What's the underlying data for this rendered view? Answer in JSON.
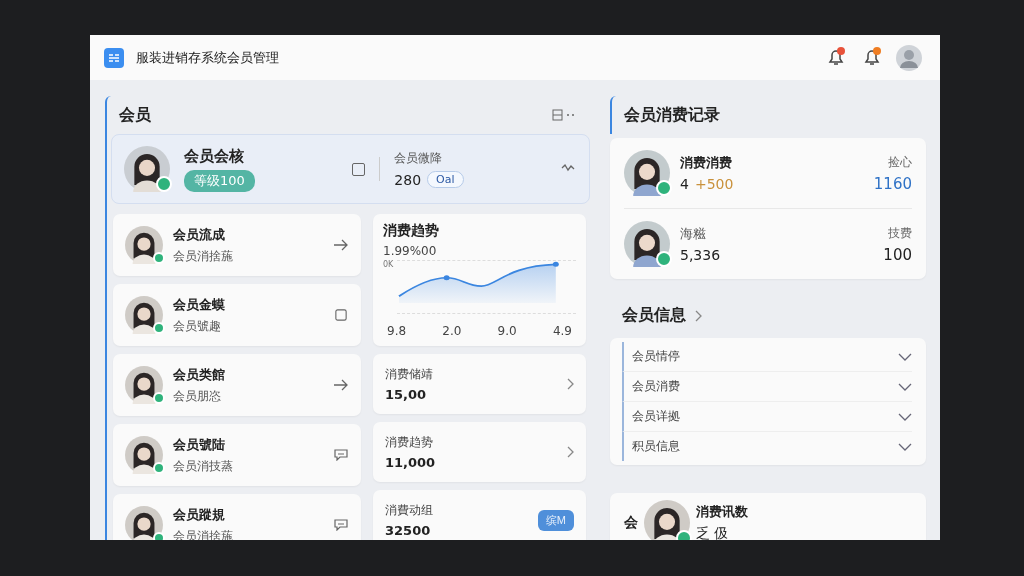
{
  "header": {
    "title": "服装进销存系统会员管理"
  },
  "members_panel": {
    "title": "会员",
    "featured": {
      "name": "会员会核",
      "level_badge": "等级100",
      "stat_label": "会员微降",
      "stat_value": "280",
      "stat_pill": "Oal",
      "checked": false
    },
    "members": [
      {
        "name": "会员流成",
        "subtitle": "会员消捨葹",
        "kind": "arrow"
      },
      {
        "name": "会员金蟆",
        "subtitle": "会员號趣",
        "kind": "square"
      },
      {
        "name": "会员类館",
        "subtitle": "会员朋恣",
        "kind": "arrow"
      },
      {
        "name": "会员號陆",
        "subtitle": "会员消技蒸",
        "kind": "chat"
      },
      {
        "name": "会员蹤規",
        "subtitle": "会员消捨葹",
        "kind": "chat"
      }
    ],
    "trend": {
      "title": "消费趋势",
      "total": "1.99%00",
      "y_label": "0K",
      "x_labels": [
        "9.8",
        "2.0",
        "9.0",
        "4.9"
      ]
    },
    "stats": [
      {
        "label": "消费储靖",
        "value": "15,00"
      },
      {
        "label": "消费趋势",
        "value": "11,000"
      },
      {
        "label": "消費动组",
        "value": "32500",
        "button": "缤M"
      }
    ]
  },
  "records_panel": {
    "title": "会员消费记录",
    "records": [
      {
        "name": "消费消费",
        "count": "4",
        "delta": "+500",
        "right_label": "捡心",
        "amount": "1160",
        "highlight": true
      },
      {
        "name": "海糍",
        "count": "5,336",
        "right_label": "技费",
        "amount": "100",
        "highlight": false
      }
    ]
  },
  "info_panel": {
    "title": "会员信息",
    "items": [
      {
        "label": "会员情停"
      },
      {
        "label": "会员消费"
      },
      {
        "label": "会员详拠"
      },
      {
        "label": "积员信息"
      }
    ],
    "bottom_card": {
      "prefix": "会",
      "name": "消费讯数",
      "subtitle": "乏 伋"
    }
  }
}
